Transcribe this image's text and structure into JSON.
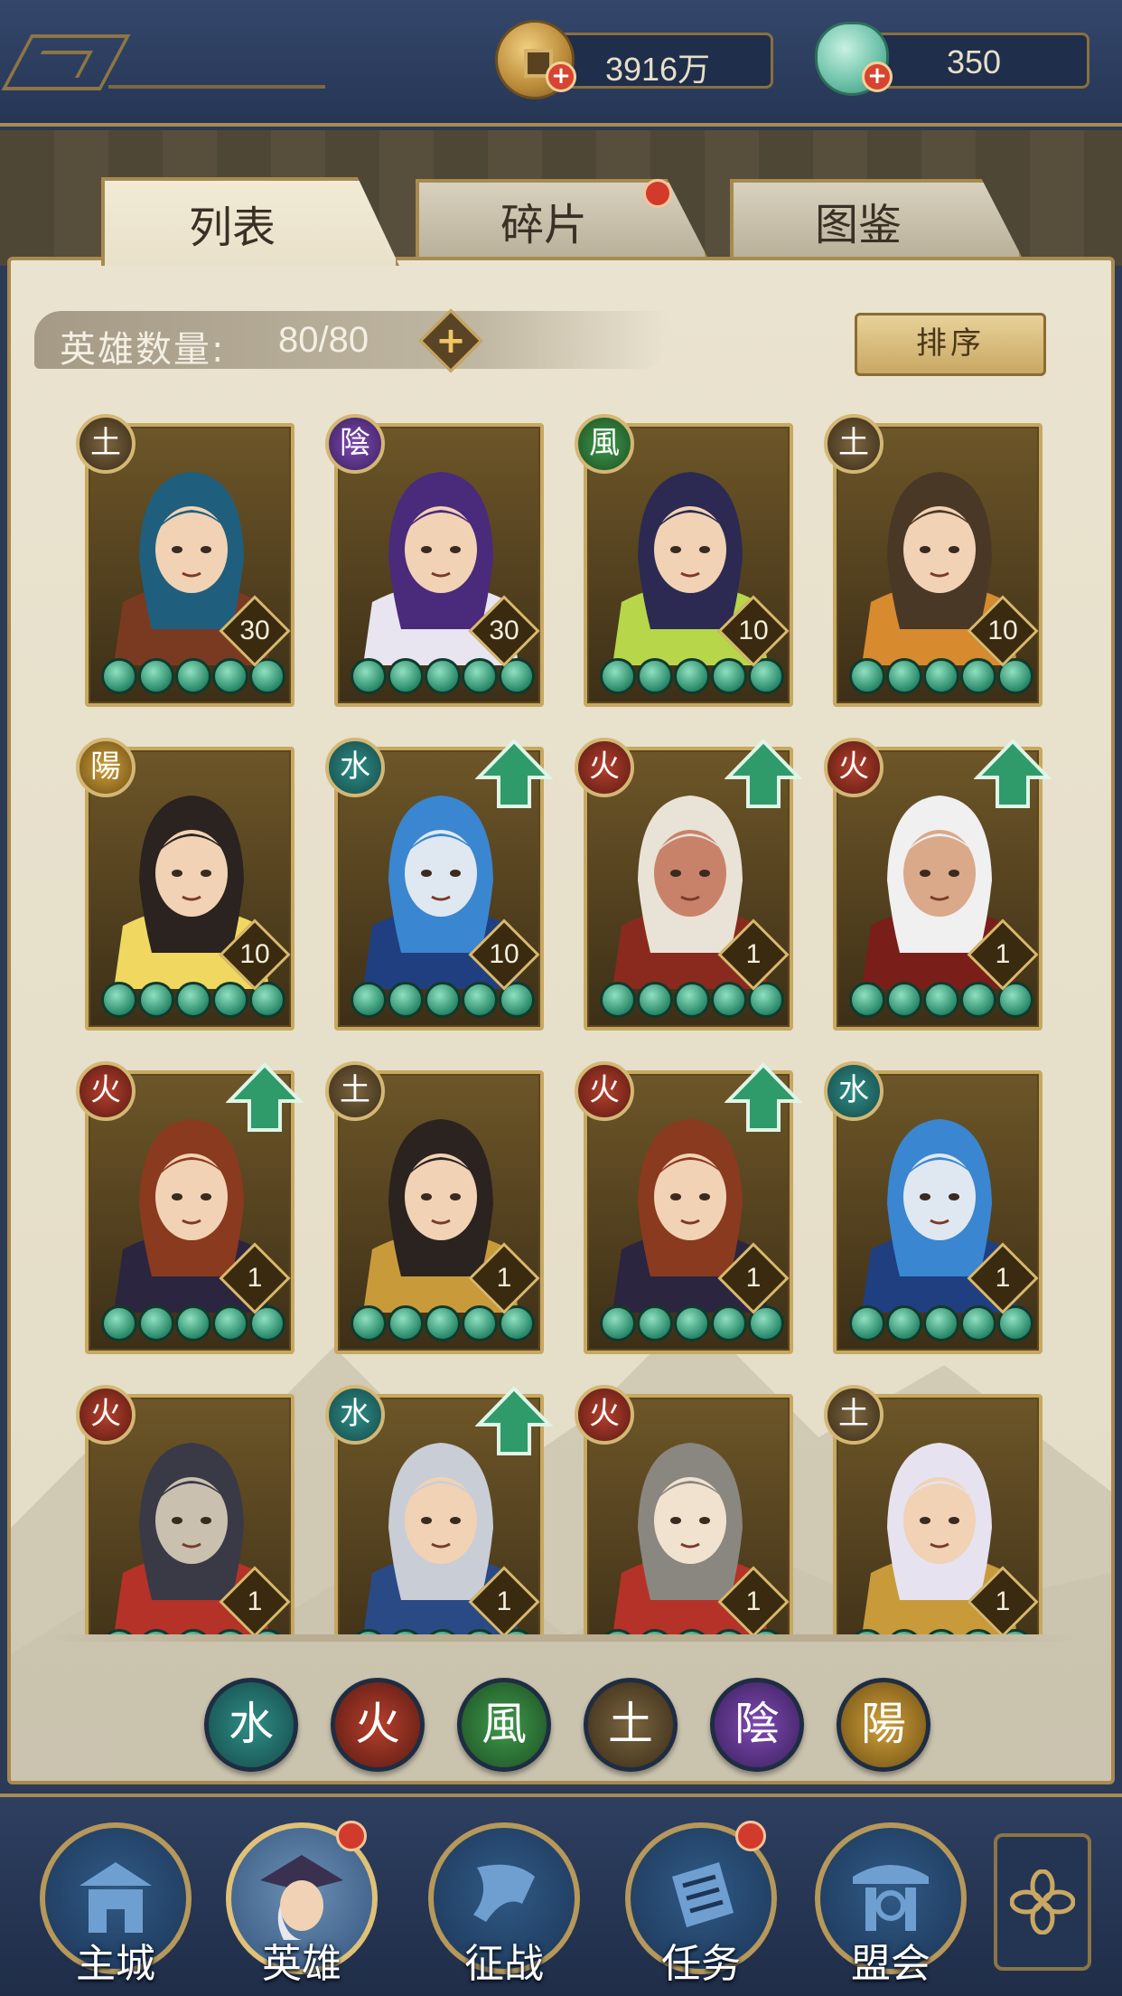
{
  "header": {
    "coins": "3916万",
    "jade": "350"
  },
  "tabs": [
    {
      "label": "列表",
      "active": true
    },
    {
      "label": "碎片",
      "active": false,
      "badge": true
    },
    {
      "label": "图鉴",
      "active": false
    }
  ],
  "hero_count": {
    "label": "英雄数量:",
    "value": "80/80"
  },
  "sort_label": "排序",
  "heroes": [
    {
      "element": "earth",
      "glyph": "土",
      "level": "30",
      "upgrade": false,
      "palette": [
        "#1f5f7d",
        "#7a3a22",
        "#f1d2b4"
      ]
    },
    {
      "element": "yin",
      "glyph": "陰",
      "level": "30",
      "upgrade": false,
      "palette": [
        "#4a2a7a",
        "#e8e4f0",
        "#f1d2b4"
      ]
    },
    {
      "element": "wood",
      "glyph": "風",
      "level": "10",
      "upgrade": false,
      "palette": [
        "#2c2a52",
        "#b7d64a",
        "#f1d2b4"
      ]
    },
    {
      "element": "earth",
      "glyph": "土",
      "level": "10",
      "upgrade": false,
      "palette": [
        "#4a3826",
        "#d88a2e",
        "#f1d2b4"
      ]
    },
    {
      "element": "yang",
      "glyph": "陽",
      "level": "10",
      "upgrade": false,
      "palette": [
        "#2a2320",
        "#f0d860",
        "#f1d2b4"
      ]
    },
    {
      "element": "water",
      "glyph": "水",
      "level": "10",
      "upgrade": true,
      "palette": [
        "#3a86d0",
        "#1f3f80",
        "#dfe8f0"
      ]
    },
    {
      "element": "fire",
      "glyph": "火",
      "level": "1",
      "upgrade": true,
      "palette": [
        "#e9e2d6",
        "#8a2a1e",
        "#c9826a"
      ]
    },
    {
      "element": "fire",
      "glyph": "火",
      "level": "1",
      "upgrade": true,
      "palette": [
        "#f0f0f0",
        "#7a1e1a",
        "#d9a98a"
      ]
    },
    {
      "element": "fire",
      "glyph": "火",
      "level": "1",
      "upgrade": true,
      "palette": [
        "#8a3a1e",
        "#2c2540",
        "#f1d2b4"
      ]
    },
    {
      "element": "earth",
      "glyph": "土",
      "level": "1",
      "upgrade": false,
      "palette": [
        "#2a2320",
        "#c99a3a",
        "#f1d2b4"
      ]
    },
    {
      "element": "fire",
      "glyph": "火",
      "level": "1",
      "upgrade": true,
      "palette": [
        "#8a3a1e",
        "#2c2540",
        "#f1d2b4"
      ]
    },
    {
      "element": "water",
      "glyph": "水",
      "level": "1",
      "upgrade": false,
      "palette": [
        "#3a86d0",
        "#1f3f80",
        "#dfe8f0"
      ]
    },
    {
      "element": "fire",
      "glyph": "火",
      "level": "1",
      "upgrade": false,
      "palette": [
        "#3a3a46",
        "#b53228",
        "#c9c0b0"
      ]
    },
    {
      "element": "water",
      "glyph": "水",
      "level": "1",
      "upgrade": true,
      "palette": [
        "#c9cdd6",
        "#2a4a86",
        "#f1d2b4"
      ]
    },
    {
      "element": "fire",
      "glyph": "火",
      "level": "1",
      "upgrade": false,
      "palette": [
        "#8a8680",
        "#b53228",
        "#f1e2d0"
      ]
    },
    {
      "element": "earth",
      "glyph": "土",
      "level": "1",
      "upgrade": false,
      "palette": [
        "#e6e2f0",
        "#c99a3a",
        "#f1d2b4"
      ]
    }
  ],
  "element_filters": [
    {
      "element": "water",
      "glyph": "水"
    },
    {
      "element": "fire",
      "glyph": "火"
    },
    {
      "element": "wood",
      "glyph": "風"
    },
    {
      "element": "earth",
      "glyph": "土"
    },
    {
      "element": "yin",
      "glyph": "陰"
    },
    {
      "element": "yang",
      "glyph": "陽"
    }
  ],
  "nav": [
    {
      "label": "主城",
      "icon": "city-gate-icon",
      "active": false,
      "badge": false
    },
    {
      "label": "英雄",
      "icon": "hero-portrait-icon",
      "active": true,
      "badge": true
    },
    {
      "label": "征战",
      "icon": "war-horn-icon",
      "active": false,
      "badge": false
    },
    {
      "label": "任务",
      "icon": "task-scroll-icon",
      "active": false,
      "badge": true
    },
    {
      "label": "盟会",
      "icon": "alliance-hall-icon",
      "active": false,
      "badge": false
    }
  ],
  "colors": {
    "accent_gold": "#c7a860",
    "panel_bg": "#e8e1cc",
    "nav_bg": "#2b3a57",
    "badge_red": "#d23b2b",
    "upgrade_green": "#2f9a6a"
  }
}
